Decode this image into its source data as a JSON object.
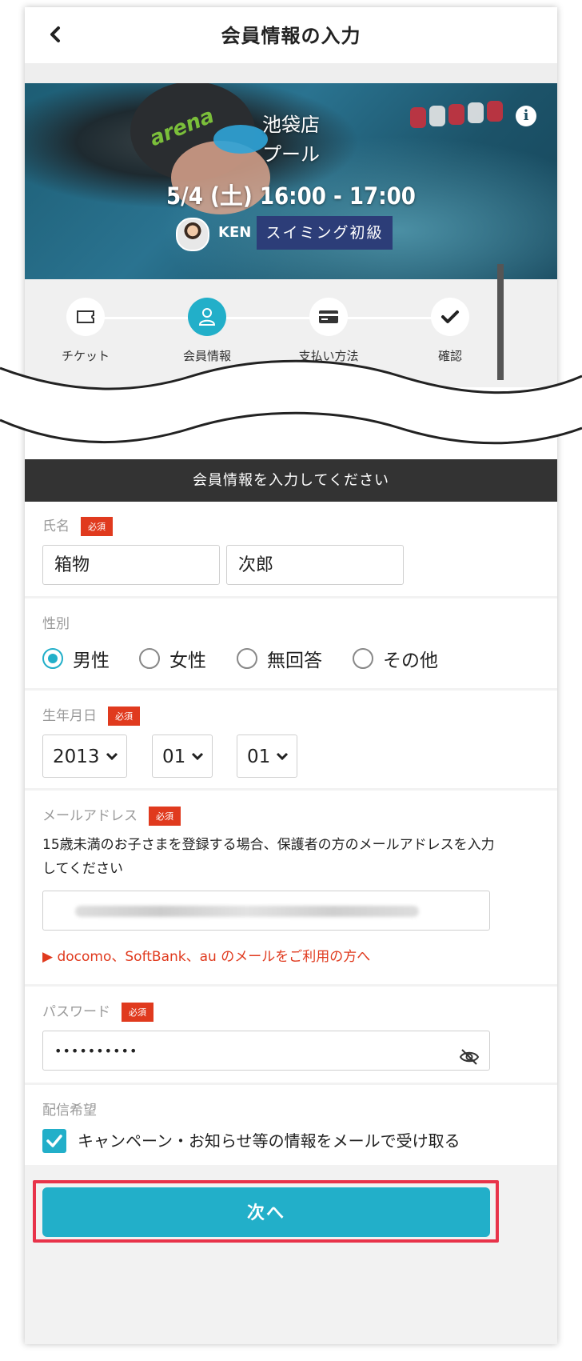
{
  "header": {
    "back_icon": "chevron-left-icon",
    "title": "会員情報の入力"
  },
  "hero": {
    "store": "池袋店",
    "room": "プール",
    "datetime": "5/4 (土) 16:00 - 17:00",
    "trainer": "KEN",
    "class_tag": "スイミング初級",
    "info_icon": "info-icon",
    "info_glyph": "i"
  },
  "steps": [
    {
      "label": "チケット",
      "icon": "ticket-icon",
      "active": false
    },
    {
      "label": "会員情報",
      "icon": "user-icon",
      "active": true
    },
    {
      "label": "支払い方法",
      "icon": "credit-card-icon",
      "active": false
    },
    {
      "label": "確認",
      "icon": "check-icon",
      "active": false
    }
  ],
  "form": {
    "banner": "会員情報を入力してください",
    "required_badge": "必須",
    "name": {
      "label": "氏名",
      "last": "箱物",
      "first": "次郎"
    },
    "gender": {
      "label": "性別",
      "options": [
        "男性",
        "女性",
        "無回答",
        "その他"
      ],
      "selected": "男性"
    },
    "birthday": {
      "label": "生年月日",
      "year": "2013",
      "month": "01",
      "day": "01"
    },
    "email": {
      "label": "メールアドレス",
      "note": "15歳未満のお子さまを登録する場合、保護者の方のメールアドレスを入力してください",
      "link": "▶ docomo、SoftBank、au のメールをご利用の方へ"
    },
    "password": {
      "label": "パスワード",
      "value": "••••••••••",
      "toggle_icon": "eye-off-icon"
    },
    "newsletter": {
      "label": "配信希望",
      "checkbox_label": "キャンペーン・お知らせ等の情報をメールで受け取る",
      "checked": true
    }
  },
  "next_button": "次へ",
  "colors": {
    "accent": "#22afc9",
    "required": "#e03a1e",
    "highlight": "#e8334a",
    "class_tag": "#2c3d78"
  }
}
